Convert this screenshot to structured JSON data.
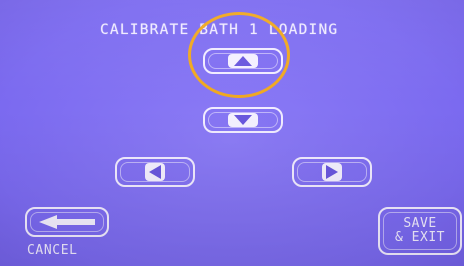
{
  "title": "CALIBRATE BATH 1 LOADING",
  "buttons": {
    "up": {
      "icon": "arrow-up-icon"
    },
    "down": {
      "icon": "arrow-down-icon"
    },
    "left": {
      "icon": "arrow-left-icon"
    },
    "right": {
      "icon": "arrow-right-icon"
    },
    "back": {
      "icon": "back-arrow-icon",
      "label": "CANCEL"
    },
    "save": {
      "line1": "SAVE",
      "line2": "& EXIT"
    }
  },
  "colors": {
    "background": "#7b6af0",
    "text": "#efeaff",
    "highlight": "#f0a820"
  }
}
